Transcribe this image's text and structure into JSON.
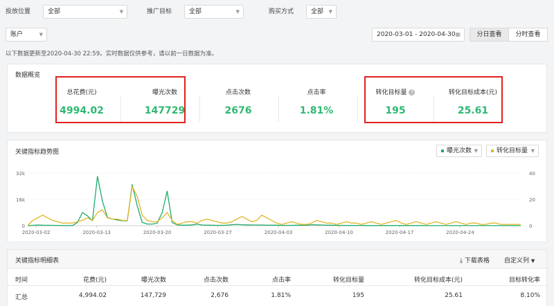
{
  "filters": {
    "placement_label": "投放位置",
    "placement_value": "全部",
    "target_label": "推广目标",
    "target_value": "全部",
    "buy_label": "购买方式",
    "buy_value": "全部",
    "account_value": "账户",
    "date_range": "2020-03-01 - 2020-04-30",
    "daily_view": "分日查看",
    "hourly_view": "分时查看"
  },
  "notice": "以下数据更新至2020-04-30 22:59。实时数据仅供参考，请以前一日数据为准。",
  "overview": {
    "title": "数据概览",
    "metrics": [
      {
        "label": "总花费(元)",
        "value": "4994.02"
      },
      {
        "label": "曝光次数",
        "value": "147729"
      },
      {
        "label": "点击次数",
        "value": "2676"
      },
      {
        "label": "点击率",
        "value": "1.81%"
      },
      {
        "label": "转化目标量",
        "value": "195"
      },
      {
        "label": "转化目标成本(元)",
        "value": "25.61"
      }
    ]
  },
  "trend": {
    "title": "关键指标趋势图",
    "legend": [
      {
        "name": "曝光次数",
        "color": "#1aab6b"
      },
      {
        "name": "转化目标量",
        "color": "#e2b526"
      }
    ]
  },
  "chart_data": {
    "type": "line",
    "x_ticks": [
      "2020-03-02",
      "2020-03-13",
      "2020-03-20",
      "2020-03-27",
      "2020-04-03",
      "2020-04-10",
      "2020-04-17",
      "2020-04-24"
    ],
    "y_left_ticks": [
      "32k",
      "16k",
      "0"
    ],
    "y_right_ticks": [
      "40",
      "20",
      "0"
    ],
    "ylim_left": [
      0,
      32000
    ],
    "ylim_right": [
      0,
      40
    ],
    "series": [
      {
        "name": "曝光次数",
        "axis": "left",
        "color": "#1aab6b",
        "values": [
          0,
          200,
          400,
          300,
          250,
          200,
          150,
          100,
          100,
          100,
          2000,
          8000,
          6000,
          3000,
          30000,
          15000,
          5000,
          4000,
          3500,
          3000,
          3000,
          25000,
          12000,
          2000,
          1000,
          1000,
          1500,
          8000,
          21000,
          2000,
          500,
          300,
          300,
          500,
          1000,
          400,
          300,
          300,
          200,
          200,
          300,
          600,
          800,
          600,
          500,
          400,
          400,
          400,
          300,
          300,
          300,
          200,
          200,
          200,
          300,
          300,
          300,
          600,
          500,
          400,
          300,
          300,
          200,
          200,
          150,
          150,
          150,
          150,
          100,
          100,
          100,
          100,
          100,
          100,
          100,
          100,
          100,
          100,
          100,
          100,
          50,
          50,
          50,
          50,
          50,
          50,
          50,
          50,
          50,
          50,
          50,
          50,
          50,
          50,
          50,
          50,
          50,
          50,
          50,
          50
        ]
      },
      {
        "name": "转化目标量",
        "axis": "right",
        "color": "#e2b526",
        "values": [
          0,
          4,
          6,
          8,
          6,
          4,
          3,
          2,
          2,
          2,
          3,
          4,
          6,
          4,
          10,
          12,
          6,
          5,
          5,
          4,
          4,
          30,
          22,
          8,
          4,
          3,
          3,
          6,
          10,
          4,
          1,
          2,
          3,
          3,
          2,
          4,
          5,
          4,
          3,
          2,
          2,
          3,
          5,
          7,
          5,
          3,
          4,
          8,
          6,
          4,
          2,
          1,
          2,
          3,
          2,
          1,
          1,
          2,
          4,
          3,
          2,
          2,
          1,
          2,
          3,
          2,
          2,
          1,
          2,
          3,
          2,
          1,
          2,
          3,
          4,
          2,
          1,
          2,
          3,
          2,
          1,
          2,
          3,
          2,
          1,
          2,
          3,
          2,
          1,
          2,
          2,
          1,
          1,
          2,
          2,
          1,
          1,
          1,
          1,
          1
        ]
      }
    ]
  },
  "detail": {
    "title": "关键指标明细表",
    "download": "下载表格",
    "custom_cols": "自定义列",
    "headers": [
      "时间",
      "花费(元)",
      "曝光次数",
      "点击次数",
      "点击率",
      "转化目标量",
      "转化目标成本(元)",
      "目标转化率"
    ],
    "summary": [
      "汇总",
      "4,994.02",
      "147,729",
      "2,676",
      "1.81%",
      "195",
      "25.61",
      "8.10%"
    ]
  }
}
